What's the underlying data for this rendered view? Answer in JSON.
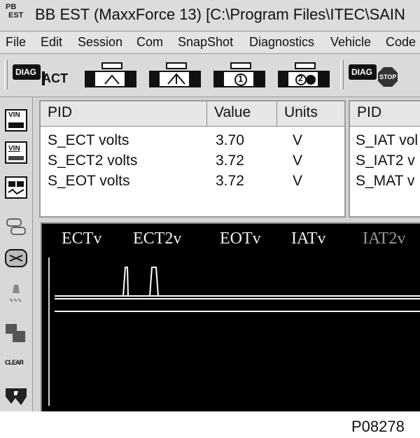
{
  "window": {
    "title": "BB EST (MaxxForce 13) [C:\\Program Files\\ITEC\\SAIN",
    "icon_text": [
      "PB",
      "EST"
    ]
  },
  "menu": [
    "File",
    "Edit",
    "Session",
    "Com",
    "SnapShot",
    "Diagnostics",
    "Vehicle",
    "Code"
  ],
  "toolbar": {
    "diag_act": {
      "badge": "DIAG",
      "label": "ACT"
    },
    "diag_stop": {
      "badge": "DIAG",
      "label": "STOP"
    },
    "icons": [
      "engine-test-icon",
      "engine-test-2-icon",
      "engine-cylinder-1-icon",
      "engine-cylinder-2-icon"
    ],
    "cylinder_labels": [
      "1",
      "2"
    ]
  },
  "left_toolbar": {
    "vin_top": "VIN",
    "vin_bottom": "VIN",
    "clear_label": "CLEAR"
  },
  "pid_table_1": {
    "headers": {
      "pid": "PID",
      "value": "Value",
      "units": "Units"
    },
    "rows": [
      {
        "pid": "S_ECT volts",
        "value": "3.70",
        "units": "V"
      },
      {
        "pid": "S_ECT2 volts",
        "value": "3.72",
        "units": "V"
      },
      {
        "pid": "S_EOT volts",
        "value": "3.72",
        "units": "V"
      }
    ]
  },
  "pid_table_2": {
    "headers": {
      "pid": "PID"
    },
    "rows": [
      {
        "pid": "S_IAT vol"
      },
      {
        "pid": "S_IAT2 v"
      },
      {
        "pid": "S_MAT v"
      }
    ]
  },
  "graph": {
    "legend": [
      "ECTv",
      "ECT2v",
      "EOTv",
      "IATv",
      "IAT2v"
    ],
    "colors": {
      "background": "#000000",
      "trace": "#ffffff",
      "dim_legend": "#9a9a9a"
    }
  },
  "figure_code": "P08278"
}
